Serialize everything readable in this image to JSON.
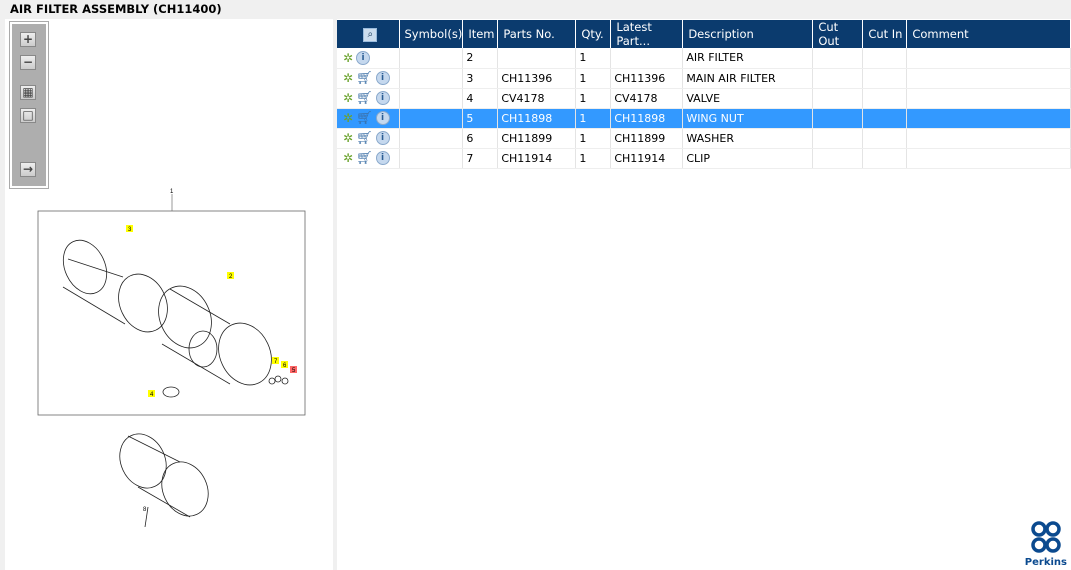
{
  "title": "AIR FILTER ASSEMBLY (CH11400)",
  "toolbar": {
    "zoom_in": "+",
    "zoom_out": "−"
  },
  "diagram": {
    "callouts": [
      "1",
      "2",
      "3",
      "4",
      "5",
      "6",
      "7",
      "8"
    ]
  },
  "table": {
    "headers": [
      "",
      "Symbol(s)",
      "Item",
      "Parts No.",
      "Qty.",
      "Latest Part...",
      "Description",
      "Cut Out",
      "Cut In",
      "Comment"
    ],
    "rows": [
      {
        "item": "2",
        "part": "",
        "qty": "1",
        "latest": "",
        "desc": "AIR FILTER",
        "cart": false,
        "selected": false
      },
      {
        "item": "3",
        "part": "CH11396",
        "qty": "1",
        "latest": "CH11396",
        "desc": "MAIN AIR FILTER",
        "cart": true,
        "selected": false
      },
      {
        "item": "4",
        "part": "CV4178",
        "qty": "1",
        "latest": "CV4178",
        "desc": "VALVE",
        "cart": true,
        "selected": false
      },
      {
        "item": "5",
        "part": "CH11898",
        "qty": "1",
        "latest": "CH11898",
        "desc": "WING NUT",
        "cart": true,
        "selected": true
      },
      {
        "item": "6",
        "part": "CH11899",
        "qty": "1",
        "latest": "CH11899",
        "desc": "WASHER",
        "cart": true,
        "selected": false
      },
      {
        "item": "7",
        "part": "CH11914",
        "qty": "1",
        "latest": "CH11914",
        "desc": "CLIP",
        "cart": true,
        "selected": false
      }
    ]
  },
  "logo": {
    "text": "Perkins"
  },
  "colors": {
    "header": "#0b3b6e",
    "selected": "#3399ff"
  }
}
